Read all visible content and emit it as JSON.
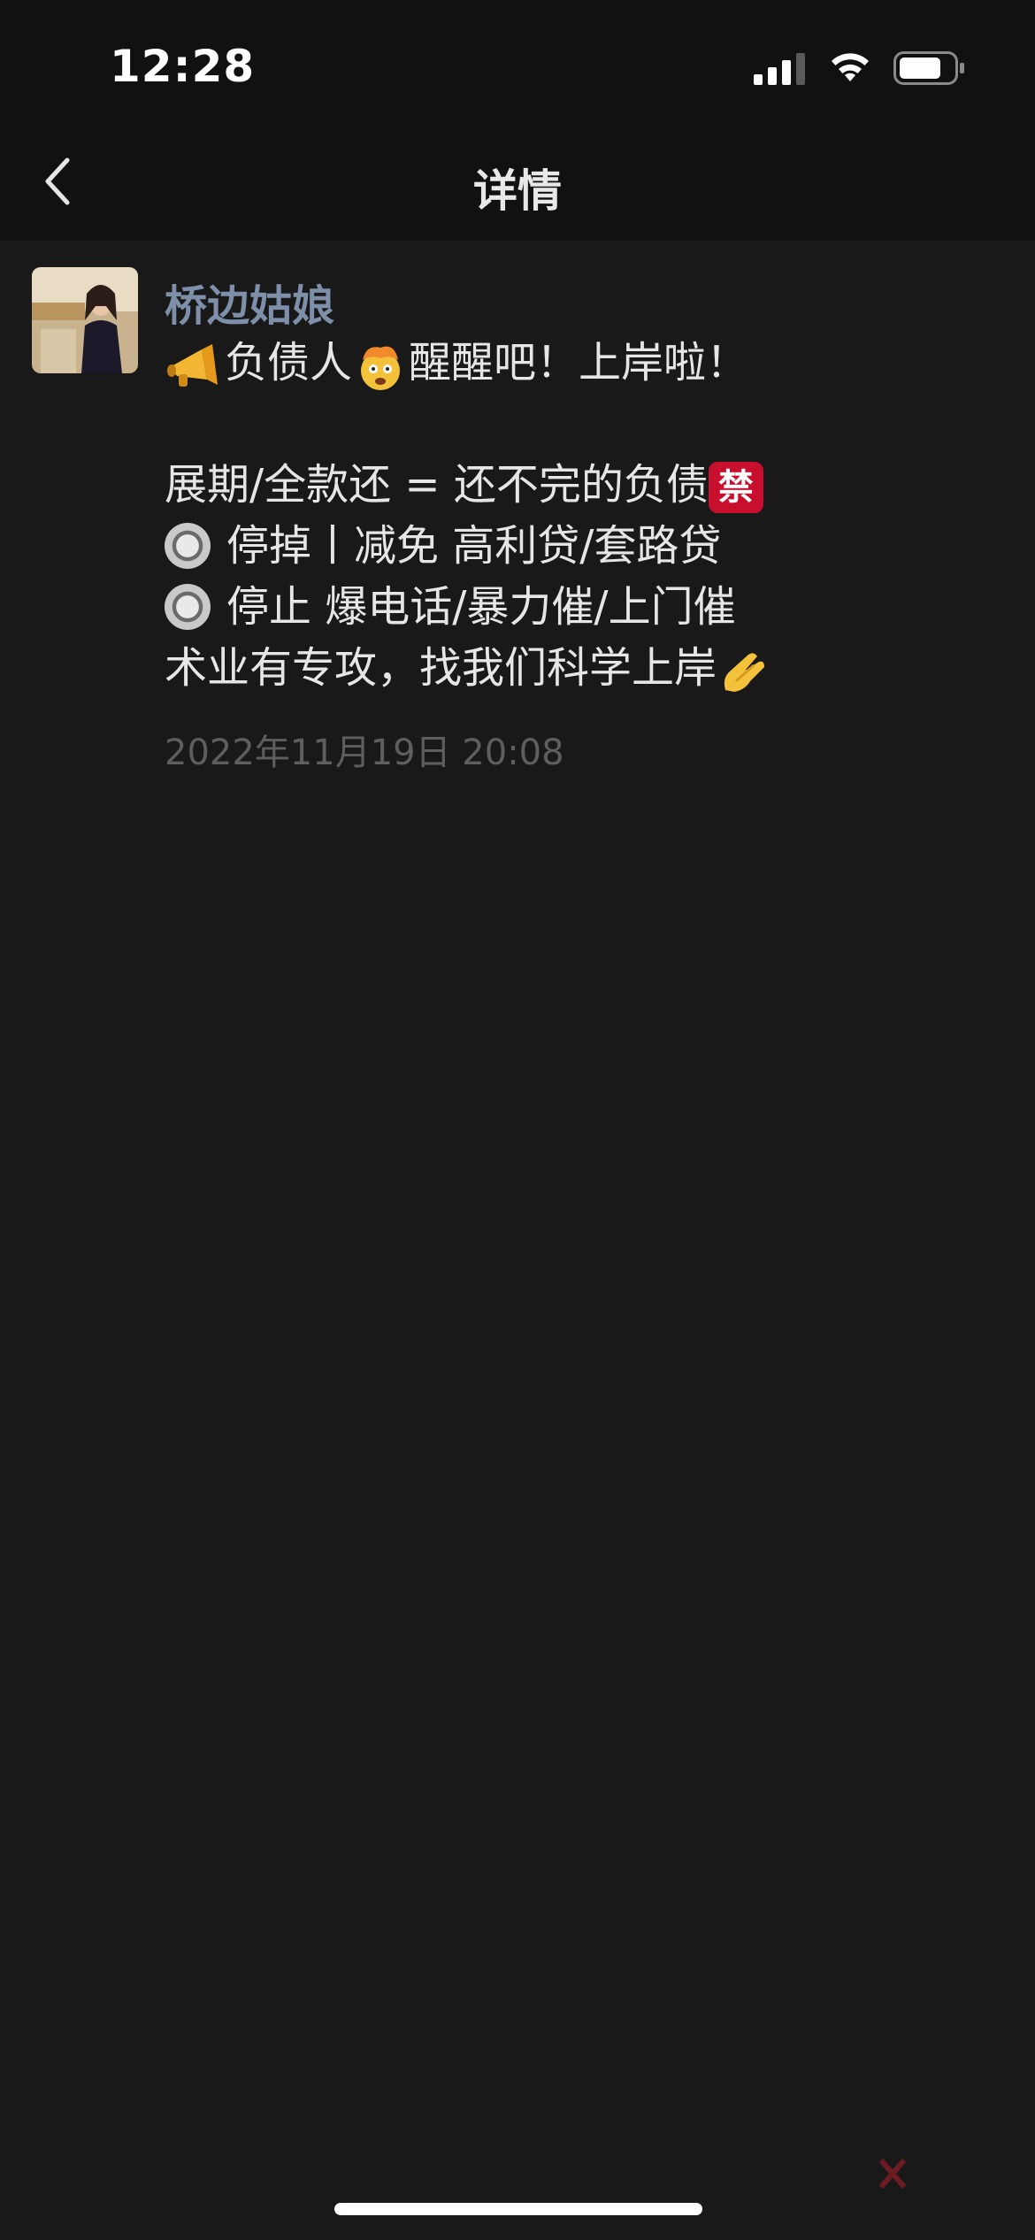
{
  "status_bar": {
    "time": "12:28"
  },
  "nav": {
    "title": "详情"
  },
  "post": {
    "author": "桥边姑娘",
    "lines": {
      "l1_text_a": "负债人",
      "l1_text_b": "醒醒吧！上岸啦！",
      "l2_text": "展期/全款还 = 还不完的负债",
      "l2_badge": "禁",
      "l3_text": "停掉丨减免  高利贷/套路贷",
      "l4_text": "停止 爆电话/暴力催/上门催",
      "l5_text": "术业有专攻，找我们科学上岸"
    },
    "icons": {
      "l1_start": "megaphone-icon",
      "l1_mid": "exploding-head-icon",
      "l5_end": "pinched-fingers-icon"
    },
    "timestamp": "2022年11月19日 20:08"
  },
  "colors": {
    "background": "#191919",
    "author": "#7e8fa9",
    "timestamp": "#5e5e5e"
  }
}
